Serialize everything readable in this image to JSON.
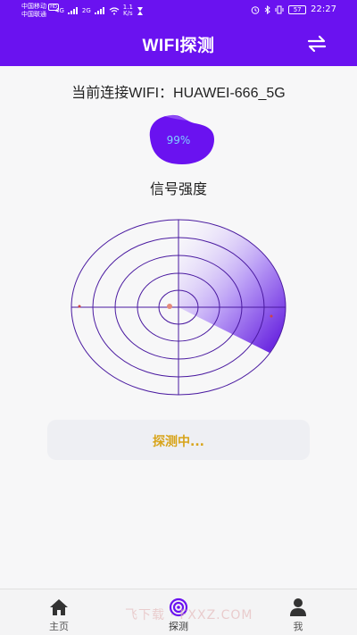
{
  "status_bar": {
    "carrier1": "中国移动",
    "carrier1_badge": "HD",
    "carrier2": "中国联通",
    "net1": "4G",
    "net2": "2G",
    "speed_value": "1.1",
    "speed_unit": "K/s",
    "battery": "57",
    "time": "22:27"
  },
  "header": {
    "title": "WIFI探测",
    "switch_icon": "swap-arrows-icon"
  },
  "connection": {
    "label": "当前连接WIFI：HUAWEI-666_5G"
  },
  "signal": {
    "percent_text": "99%",
    "percent_value": 99,
    "label": "信号强度"
  },
  "radar": {
    "ring_count": 5,
    "sweep_color": "#6a12f0",
    "dot_color": "#e48b7b"
  },
  "detection": {
    "status_text": "探测中..."
  },
  "nav": {
    "items": [
      {
        "label": "主页",
        "icon": "home-icon"
      },
      {
        "label": "探测",
        "icon": "radar-icon"
      },
      {
        "label": "我",
        "icon": "person-icon"
      }
    ],
    "active_index": 1
  },
  "colors": {
    "primary": "#6a12f0",
    "status_text": "#d8a41a",
    "percent_text": "#7ed0ff"
  },
  "watermark": "飞下载 · FXXZ.COM"
}
